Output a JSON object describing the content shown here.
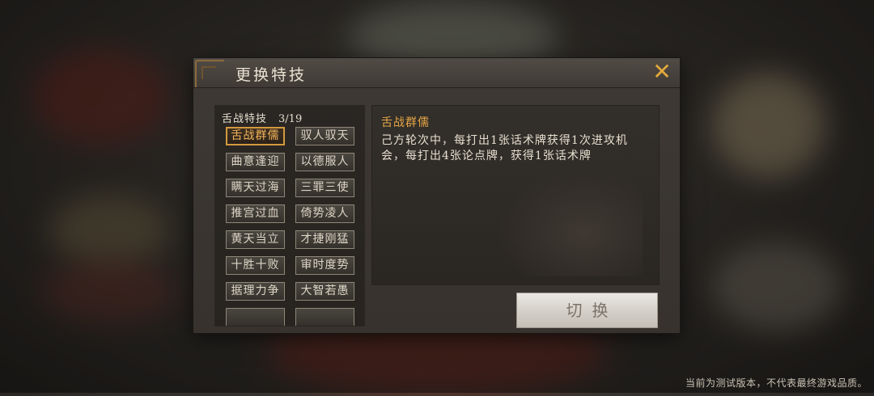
{
  "dialog": {
    "title": "更换特技",
    "close_symbol": "✕"
  },
  "skill_list": {
    "header_label": "舌战特技",
    "count": "3/19",
    "selected_index": 0,
    "items": [
      "舌战群儒",
      "驭人驭天",
      "曲意逢迎",
      "以德服人",
      "瞒天过海",
      "三罪三使",
      "推宫过血",
      "倚势凌人",
      "黄天当立",
      "才捷刚猛",
      "十胜十败",
      "审时度势",
      "据理力争",
      "大智若愚",
      "",
      ""
    ]
  },
  "description": {
    "title": "舌战群儒",
    "text": "己方轮次中，每打出1张话术牌获得1次进攻机会，每打出4张论点牌，获得1张话术牌"
  },
  "switch_button": {
    "label": "切换"
  },
  "footer": {
    "note": "当前为测试版本，不代表最终游戏品质。"
  },
  "colors": {
    "accent_gold": "#e6a646",
    "selected_border": "#d39a3c",
    "close_icon": "#e3a93c"
  }
}
